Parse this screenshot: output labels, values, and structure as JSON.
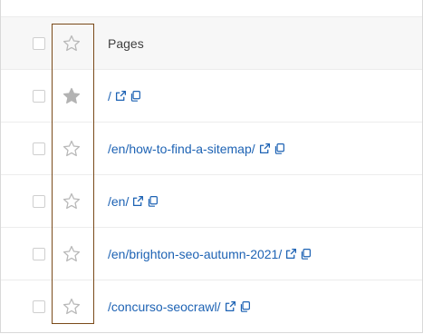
{
  "table": {
    "header": {
      "column_label": "Pages"
    },
    "rows": [
      {
        "path": "/",
        "starred": true
      },
      {
        "path": "/en/how-to-find-a-sitemap/",
        "starred": false
      },
      {
        "path": "/en/",
        "starred": false
      },
      {
        "path": "/en/brighton-seo-autumn-2021/",
        "starred": false
      },
      {
        "path": "/concurso-seocrawl/",
        "starred": false
      }
    ]
  },
  "colors": {
    "link": "#1e63b4",
    "star_filled": "#b3b3b3",
    "star_outline": "#b8b8b8",
    "highlight_border": "#7a4a1a"
  },
  "icons": {
    "star": "star-icon",
    "external_link": "external-link-icon",
    "copy": "copy-icon"
  }
}
